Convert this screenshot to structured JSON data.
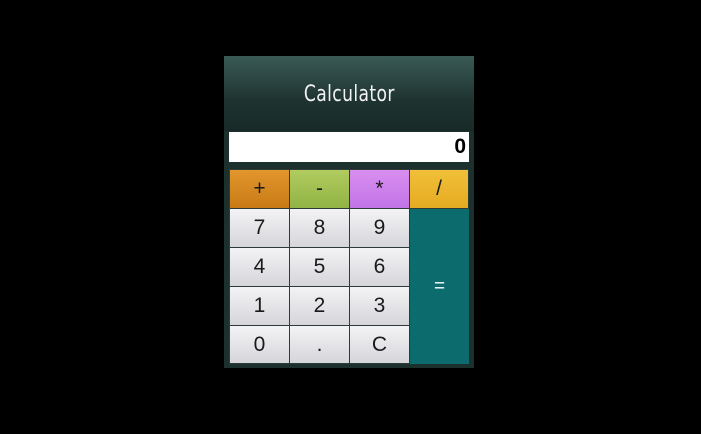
{
  "calculator": {
    "title": "Calculator",
    "display_value": "0"
  },
  "operators": {
    "add": "+",
    "subtract": "-",
    "multiply": "*",
    "divide": "/"
  },
  "keys": {
    "seven": "7",
    "eight": "8",
    "nine": "9",
    "four": "4",
    "five": "5",
    "six": "6",
    "one": "1",
    "two": "2",
    "three": "3",
    "zero": "0",
    "decimal": ".",
    "clear": "C",
    "equals": "="
  },
  "colors": {
    "page_background": "#000000",
    "calculator_body": "#1c302d",
    "add_key": "#d98823",
    "subtract_key": "#a1bf52",
    "multiply_key": "#cd80eb",
    "divide_key": "#ebb52d",
    "equals_key": "#0b6b6d",
    "number_key": "#e4e3e7"
  }
}
